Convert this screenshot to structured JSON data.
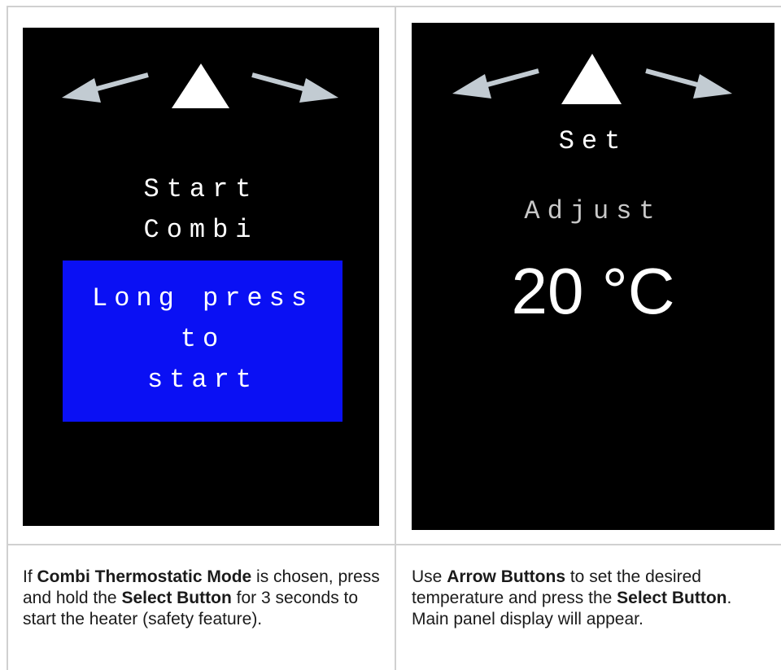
{
  "left_screen": {
    "line1": "Start",
    "line2": "Combi",
    "highlight_lines": [
      "Long press",
      "to",
      "start"
    ],
    "highlight_color": "#0a10f4",
    "icons": [
      "left-arrow-icon",
      "up-triangle-icon",
      "right-arrow-icon"
    ]
  },
  "right_screen": {
    "title": "Set",
    "subtitle": "Adjust",
    "temperature": "20 °C",
    "icons": [
      "left-arrow-icon",
      "up-triangle-icon",
      "right-arrow-icon"
    ]
  },
  "captions": {
    "left": {
      "p1": "If ",
      "b1": "Combi Thermostatic Mode",
      "p2": " is chosen, press and hold the ",
      "b2": "Select Button",
      "p3": " for 3 seconds to start the heater (safety feature)."
    },
    "right": {
      "p1": "Use ",
      "b1": "Arrow Buttons",
      "p2": " to set the desired temperature and press the ",
      "b2": "Select Button",
      "p3": ". Main panel display will appear."
    }
  }
}
